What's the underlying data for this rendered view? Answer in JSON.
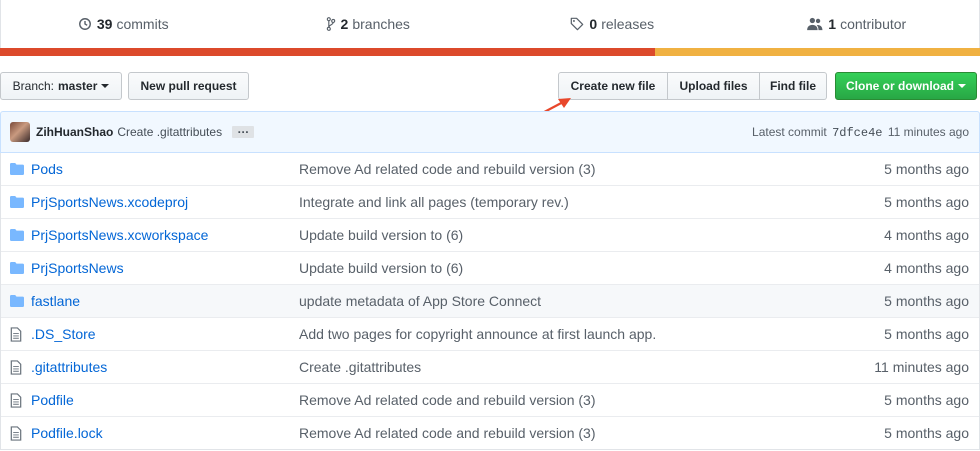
{
  "summary": {
    "commits": {
      "count": "39",
      "label": "commits",
      "icon": "history-icon"
    },
    "branches": {
      "count": "2",
      "label": "branches",
      "icon": "git-branch-icon"
    },
    "releases": {
      "count": "0",
      "label": "releases",
      "icon": "tag-icon"
    },
    "contributors": {
      "count": "1",
      "label": "contributor",
      "icon": "people-icon"
    }
  },
  "colors": {
    "lang_primary": "#dc4a2b",
    "lang_secondary": "#f0b142",
    "accent_link": "#0366d6",
    "clone_green": "#28a745",
    "annotation_arrow": "#e8472b"
  },
  "toolbar": {
    "branch_prefix": "Branch:",
    "branch_name": "master",
    "new_pull_request": "New pull request",
    "create_new_file": "Create new file",
    "upload_files": "Upload files",
    "find_file": "Find file",
    "clone_or_download": "Clone or download"
  },
  "latest_commit": {
    "author": "ZihHuanShao",
    "message": "Create .gitattributes",
    "ellipsis": "…",
    "prefix": "Latest commit",
    "sha": "7dfce4e",
    "age": "11 minutes ago"
  },
  "files": [
    {
      "type": "dir",
      "icon": "folder-icon",
      "name": "Pods",
      "message": "Remove Ad related code and rebuild version (3)",
      "age": "5 months ago"
    },
    {
      "type": "dir",
      "icon": "folder-icon",
      "name": "PrjSportsNews.xcodeproj",
      "message": "Integrate and link all pages (temporary rev.)",
      "age": "5 months ago"
    },
    {
      "type": "dir",
      "icon": "folder-icon",
      "name": "PrjSportsNews.xcworkspace",
      "message": "Update build version to (6)",
      "age": "4 months ago"
    },
    {
      "type": "dir",
      "icon": "folder-icon",
      "name": "PrjSportsNews",
      "message": "Update build version to (6)",
      "age": "4 months ago"
    },
    {
      "type": "dir",
      "icon": "folder-icon",
      "name": "fastlane",
      "message": "update metadata of App Store Connect",
      "age": "5 months ago"
    },
    {
      "type": "file",
      "icon": "file-icon",
      "name": ".DS_Store",
      "message": "Add two pages for copyright announce at first launch app.",
      "age": "5 months ago"
    },
    {
      "type": "file",
      "icon": "file-icon",
      "name": ".gitattributes",
      "message": "Create .gitattributes",
      "age": "11 minutes ago"
    },
    {
      "type": "file",
      "icon": "file-icon",
      "name": "Podfile",
      "message": "Remove Ad related code and rebuild version (3)",
      "age": "5 months ago"
    },
    {
      "type": "file",
      "icon": "file-icon",
      "name": "Podfile.lock",
      "message": "Remove Ad related code and rebuild version (3)",
      "age": "5 months ago"
    }
  ]
}
